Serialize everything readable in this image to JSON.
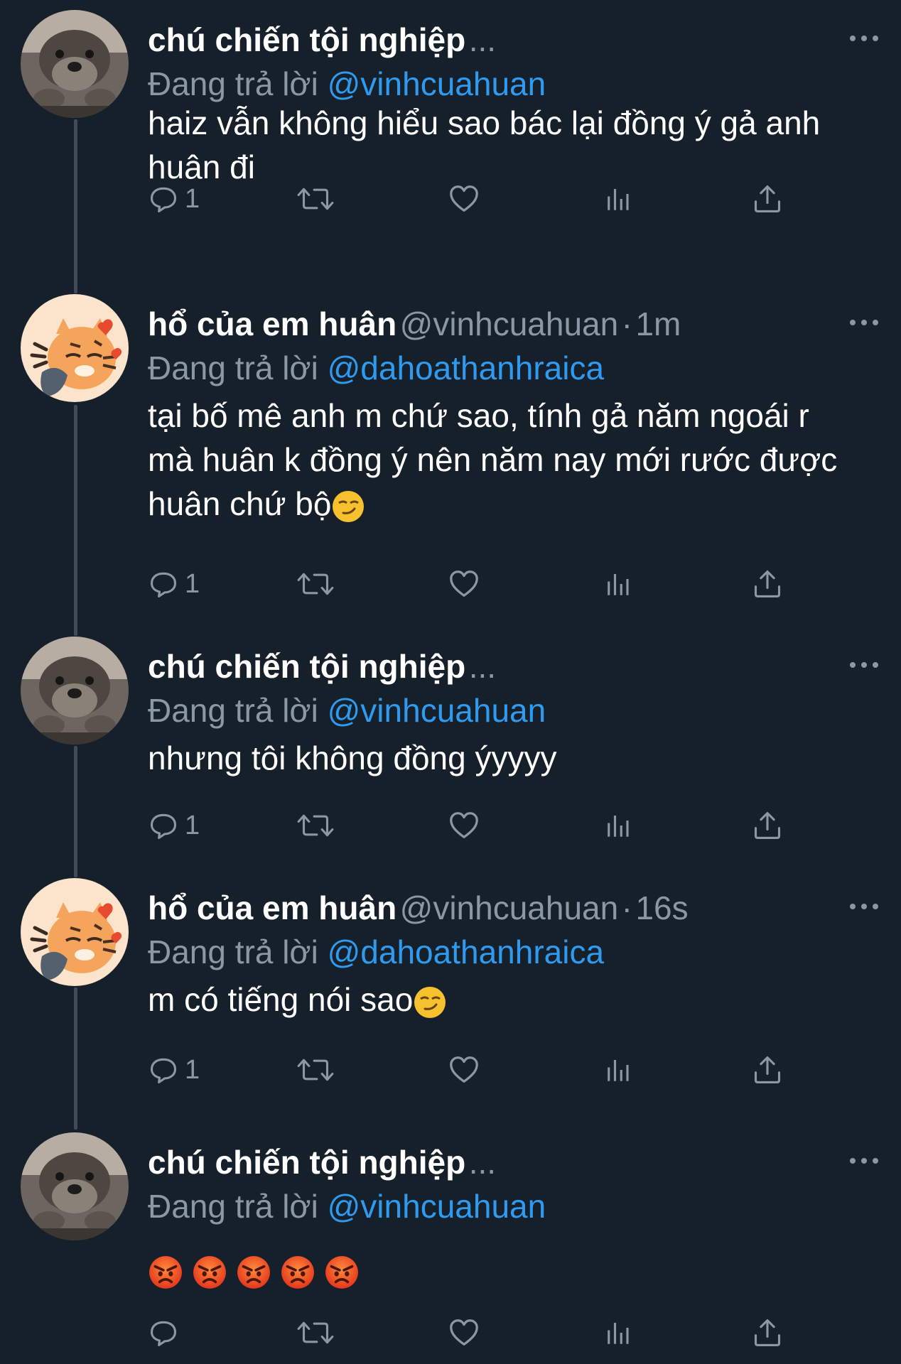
{
  "colors": {
    "background": "#16202b",
    "text": "#ffffff",
    "muted": "#8a97a4",
    "mention": "#2f9bf0",
    "thread_line": "#3e4b58"
  },
  "tweets": [
    {
      "name": "chú chiến tội nghiệp",
      "handle": "",
      "time": "",
      "name_truncated": "...",
      "replying_label": "Đang trả lời",
      "replying_to": "@vinhcuahuan",
      "text": "haiz vẫn không hiểu sao bác lại đồng ý gả anh huân đi",
      "reply_count": "1",
      "avatar": "otter-avatar"
    },
    {
      "name": "hổ của em huân",
      "handle": "@vinhcuahuan",
      "separator": "·",
      "time": "1m",
      "replying_label": "Đang trả lời",
      "replying_to": "@dahoathanhraica",
      "text": "tại bố mê anh m chứ sao, tính gả năm ngoái r mà huân k đồng ý nên năm nay mới rước được huân chứ bộ",
      "emoji": "smirking-face",
      "reply_count": "1",
      "avatar": "tiger-cat-avatar"
    },
    {
      "name": "chú chiến tội nghiệp",
      "handle": "",
      "time": "",
      "name_truncated": "...",
      "replying_label": "Đang trả lời",
      "replying_to": "@vinhcuahuan",
      "text": "nhưng tôi không đồng ýyyyy",
      "reply_count": "1",
      "avatar": "otter-avatar"
    },
    {
      "name": "hổ của em huân",
      "handle": "@vinhcuahuan",
      "separator": "·",
      "time": "16s",
      "replying_label": "Đang trả lời",
      "replying_to": "@dahoathanhraica",
      "text": "m có tiếng nói sao",
      "emoji": "smirking-face",
      "reply_count": "1",
      "avatar": "tiger-cat-avatar"
    },
    {
      "name": "chú chiến tội nghiệp",
      "handle": "",
      "time": "",
      "name_truncated": "...",
      "replying_label": "Đang trả lời",
      "replying_to": "@vinhcuahuan",
      "text": "",
      "emojis": [
        "angry-face",
        "angry-face",
        "angry-face",
        "angry-face",
        "angry-face"
      ],
      "reply_count": "",
      "avatar": "otter-avatar"
    }
  ],
  "icons": {
    "reply": "reply-icon",
    "retweet": "retweet-icon",
    "like": "heart-icon",
    "analytics": "analytics-icon",
    "share": "share-icon",
    "more": "more-dots-icon"
  }
}
